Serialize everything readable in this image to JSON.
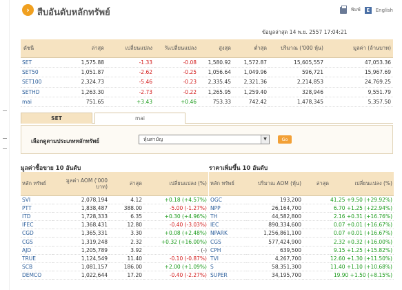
{
  "page_title": "สืบอันดับหลักทรัพย์",
  "toolbar": {
    "print_label": "พิมพ์",
    "english_label": "English",
    "print_icon": "print-icon",
    "lang_icon": "english-icon"
  },
  "timestamp": "ข้อมูลล่าสุด 14 พ.ย. 2557 17:04:21",
  "index_table": {
    "headers": [
      "ดัชนี",
      "ล่าสุด",
      "เปลี่ยนแปลง",
      "%เปลี่ยนแปลง",
      "สูงสุด",
      "ต่ำสุด",
      "ปริมาณ ('000 หุ้น)",
      "มูลค่า (ล้านบาท)"
    ],
    "rows": [
      {
        "name": "SET",
        "last": "1,575.88",
        "change": "-1.33",
        "pct": "-0.08",
        "high": "1,580.92",
        "low": "1,572.87",
        "volume": "15,605,557",
        "value": "47,053.36",
        "dir": "neg"
      },
      {
        "name": "SET50",
        "last": "1,051.87",
        "change": "-2.62",
        "pct": "-0.25",
        "high": "1,056.64",
        "low": "1,049.96",
        "volume": "596,721",
        "value": "15,967.69",
        "dir": "neg"
      },
      {
        "name": "SET100",
        "last": "2,324.73",
        "change": "-5.46",
        "pct": "-0.23",
        "high": "2,335.45",
        "low": "2,321.36",
        "volume": "2,214,853",
        "value": "24,769.25",
        "dir": "neg"
      },
      {
        "name": "SETHD",
        "last": "1,263.30",
        "change": "-2.73",
        "pct": "-0.22",
        "high": "1,265.95",
        "low": "1,259.40",
        "volume": "328,946",
        "value": "9,551.79",
        "dir": "neg"
      },
      {
        "name": "mai",
        "last": "751.65",
        "change": "+3.43",
        "pct": "+0.46",
        "high": "753.33",
        "low": "742.42",
        "volume": "1,478,345",
        "value": "5,357.50",
        "dir": "pos"
      }
    ]
  },
  "tabs": [
    {
      "label": "SET",
      "active": true
    },
    {
      "label": "mai",
      "active": false
    }
  ],
  "filter": {
    "label": "เลือกดูตามประเภทหลักทรัพย์",
    "selected": "หุ้นสามัญ",
    "go_label": "Go"
  },
  "left_section": {
    "title": "มูลค่าซื้อขาย 10 อันดับ",
    "headers": [
      "หลัก ทรัพย์",
      "มูลค่า AOM ('000 บาท)",
      "ล่าสุด",
      "เปลี่ยนแปลง (%)"
    ],
    "rows": [
      {
        "sym": "SVI",
        "val": "2,078,194",
        "last": "4.12",
        "chg": "+0.18 (+4.57%)",
        "dir": "pos"
      },
      {
        "sym": "PTT",
        "val": "1,838,487",
        "last": "388.00",
        "chg": "-5.00 (-1.27%)",
        "dir": "neg"
      },
      {
        "sym": "ITD",
        "val": "1,728,333",
        "last": "6.35",
        "chg": "+0.30 (+4.96%)",
        "dir": "pos"
      },
      {
        "sym": "IFEC",
        "val": "1,368,431",
        "last": "12.80",
        "chg": "-0.40 (-3.03%)",
        "dir": "neg"
      },
      {
        "sym": "CGD",
        "val": "1,365,331",
        "last": "3.30",
        "chg": "+0.08 (+2.48%)",
        "dir": "pos"
      },
      {
        "sym": "CGS",
        "val": "1,319,248",
        "last": "2.32",
        "chg": "+0.32 (+16.00%)",
        "dir": "pos"
      },
      {
        "sym": "AJD",
        "val": "1,205,789",
        "last": "3.92",
        "chg": "- (-)",
        "dir": ""
      },
      {
        "sym": "TRUE",
        "val": "1,124,549",
        "last": "11.40",
        "chg": "-0.10 (-0.87%)",
        "dir": "neg"
      },
      {
        "sym": "SCB",
        "val": "1,081,157",
        "last": "186.00",
        "chg": "+2.00 (+1.09%)",
        "dir": "pos"
      },
      {
        "sym": "DEMCO",
        "val": "1,022,644",
        "last": "17.20",
        "chg": "-0.40 (-2.27%)",
        "dir": "neg"
      }
    ]
  },
  "right_section": {
    "title": "ราคาเพิ่มขึ้น 10 อันดับ",
    "headers": [
      "หลัก ทรัพย์",
      "ปริมาณ AOM (หุ้น)",
      "ล่าสุด",
      "เปลี่ยนแปลง (%)"
    ],
    "rows": [
      {
        "sym": "OGC",
        "vol": "193,200",
        "chg": "41.25 +9.50 (+29.92%)"
      },
      {
        "sym": "NPP",
        "vol": "26,164,700",
        "chg": "6.70 +1.25 (+22.94%)"
      },
      {
        "sym": "TH",
        "vol": "44,582,800",
        "chg": "2.16 +0.31 (+16.76%)"
      },
      {
        "sym": "IEC",
        "vol": "890,334,600",
        "chg": "0.07 +0.01 (+16.67%)"
      },
      {
        "sym": "NPARK",
        "vol": "1,256,861,100",
        "chg": "0.07 +0.01 (+16.67%)"
      },
      {
        "sym": "CGS",
        "vol": "577,424,900",
        "chg": "2.32 +0.32 (+16.00%)"
      },
      {
        "sym": "CPH",
        "vol": "639,500",
        "chg": "9.15 +1.25 (+15.82%)"
      },
      {
        "sym": "TVI",
        "vol": "4,267,700",
        "chg": "12.60 +1.30 (+11.50%)"
      },
      {
        "sym": "S",
        "vol": "58,351,300",
        "chg": "11.40 +1.10 (+10.68%)"
      },
      {
        "sym": "SUPER",
        "vol": "34,195,700",
        "chg": "19.90 +1.50 (+8.15%)"
      }
    ]
  },
  "colors": {
    "header_bg": "#f6e3c1",
    "negative": "#d21a1a",
    "positive": "#1a9a1a",
    "link": "#2a5d9a",
    "accent": "#f2a036"
  }
}
